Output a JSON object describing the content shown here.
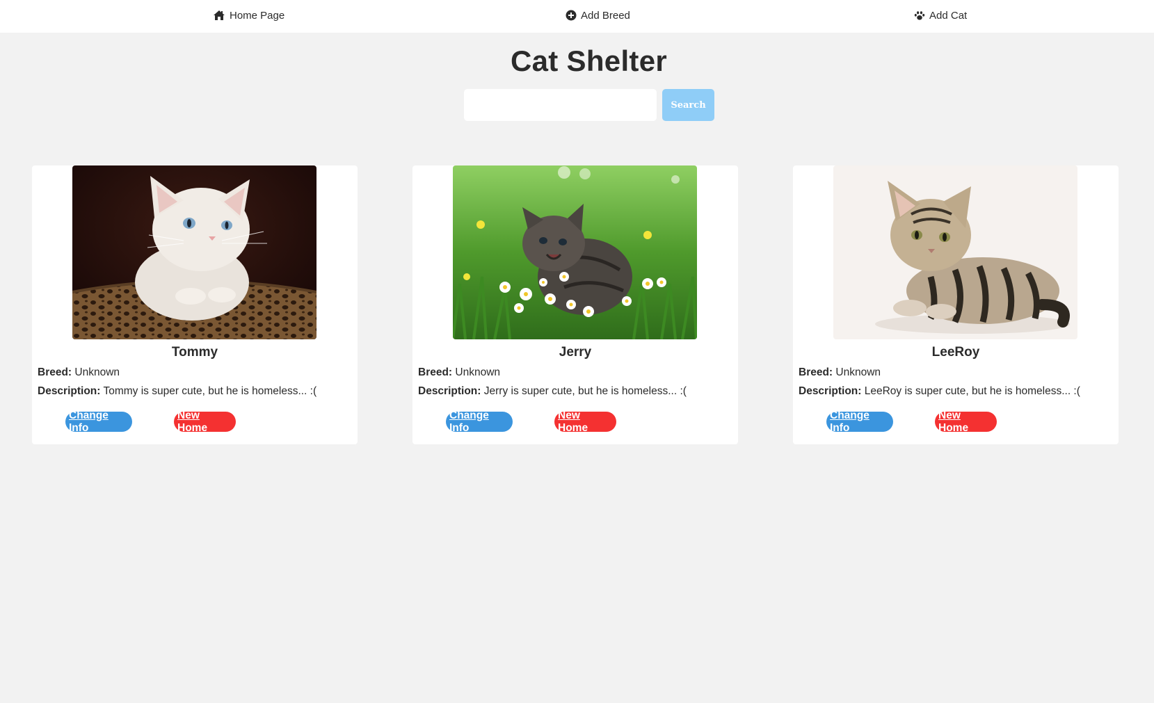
{
  "nav": {
    "items": [
      {
        "label": "Home Page",
        "icon": "home-icon"
      },
      {
        "label": "Add Breed",
        "icon": "plus-circle-icon"
      },
      {
        "label": "Add Cat",
        "icon": "paw-icon"
      }
    ]
  },
  "header": {
    "title": "Cat Shelter",
    "search_value": "",
    "search_button": "Search"
  },
  "labels": {
    "breed": "Breed:",
    "description": "Description:",
    "change_info": "Change Info",
    "new_home": "New Home"
  },
  "cats": [
    {
      "name": "Tommy",
      "breed": "Unknown",
      "description": "Tommy is super cute, but he is homeless... :("
    },
    {
      "name": "Jerry",
      "breed": "Unknown",
      "description": "Jerry is super cute, but he is homeless... :("
    },
    {
      "name": "LeeRoy",
      "breed": "Unknown",
      "description": "LeeRoy is super cute, but he is homeless... :("
    }
  ],
  "colors": {
    "change_info": "#3b95de",
    "new_home": "#f43131",
    "search_button": "#8fcdf7",
    "background": "#f2f2f2"
  }
}
